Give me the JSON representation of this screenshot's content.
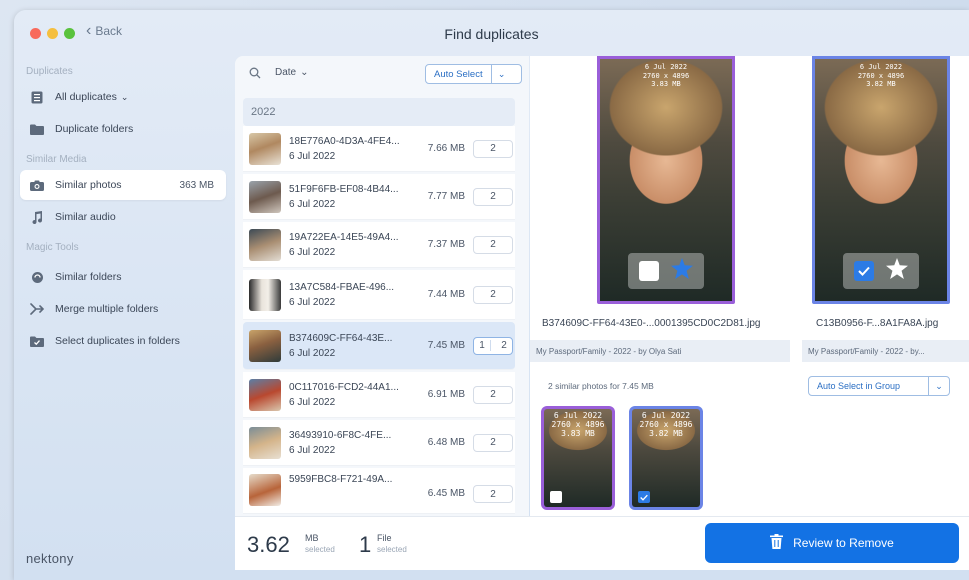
{
  "window": {
    "title": "Find duplicates",
    "back_label": "Back"
  },
  "sidebar": {
    "sections": [
      "Duplicates",
      "Similar Media",
      "Magic Tools"
    ],
    "items": [
      {
        "label": "All duplicates",
        "icon": "list-icon"
      },
      {
        "label": "Duplicate folders",
        "icon": "folder-icon"
      },
      {
        "label": "Similar photos",
        "icon": "camera-icon",
        "size": "363 MB"
      },
      {
        "label": "Similar audio",
        "icon": "music-icon"
      },
      {
        "label": "Similar folders",
        "icon": "folder-sync-icon"
      },
      {
        "label": "Merge multiple folders",
        "icon": "merge-icon"
      },
      {
        "label": "Select duplicates in folders",
        "icon": "folder-check-icon"
      }
    ],
    "logo": "nektony"
  },
  "list": {
    "date_label": "Date",
    "auto_select_label": "Auto Select",
    "group_label": "2022",
    "rows": [
      {
        "name": "18E776A0-4D3A-4FE4...",
        "date": "6 Jul 2022",
        "size": "7.66 MB",
        "count": "2"
      },
      {
        "name": "51F9F6FB-EF08-4B44...",
        "date": "6 Jul 2022",
        "size": "7.77 MB",
        "count": "2"
      },
      {
        "name": "19A722EA-14E5-49A4...",
        "date": "6 Jul 2022",
        "size": "7.37 MB",
        "count": "2"
      },
      {
        "name": "13A7C584-FBAE-496...",
        "date": "6 Jul 2022",
        "size": "7.44 MB",
        "count": "2"
      },
      {
        "name": "B374609C-FF64-43E...",
        "date": "6 Jul 2022",
        "size": "7.45 MB",
        "count_selected": "1",
        "count": "2"
      },
      {
        "name": "0C117016-FCD2-44A1...",
        "date": "6 Jul 2022",
        "size": "6.91 MB",
        "count": "2"
      },
      {
        "name": "36493910-6F8C-4FE...",
        "date": "6 Jul 2022",
        "size": "6.48 MB",
        "count": "2"
      },
      {
        "name": "5959FBC8-F721-49A...",
        "date": "",
        "size": "6.45 MB",
        "count": "2"
      }
    ]
  },
  "preview": {
    "photos": [
      {
        "date": "6 Jul 2022",
        "dims": "2760 x 4896",
        "size": "3.83 MB",
        "file_name": "B374609C-FF64-43E0-...0001395CD0C2D81.jpg",
        "path": "My Passport/Family - 2022 - by Olya Sati",
        "checked": false,
        "border": "#9a5fd9"
      },
      {
        "date": "6 Jul 2022",
        "dims": "2760 x 4896",
        "size": "3.82 MB",
        "file_name": "C13B0956-F...8A1FA8A.jpg",
        "path": "My Passport/Family - 2022 - by...",
        "checked": true,
        "border": "#6b84e6"
      }
    ],
    "similar_text": "2 similar photos for 7.45 MB",
    "auto_group_label": "Auto Select in Group",
    "small_photos": [
      {
        "date": "6 Jul 2022",
        "dims": "2760 x 4896",
        "size": "3.83 MB",
        "checked": false
      },
      {
        "date": "6 Jul 2022",
        "dims": "2760 x 4896",
        "size": "3.82 MB",
        "checked": true
      }
    ]
  },
  "bottom": {
    "selected_size": "3.62",
    "selected_unit": "MB",
    "selected_size_sub": "selected",
    "selected_files": "1",
    "selected_files_unit": "File",
    "selected_files_sub": "selected",
    "review_label": "Review to Remove"
  },
  "colors": {
    "accent": "#1372e4",
    "star": "#2c7be5",
    "selected_row": "#dbe7f7"
  }
}
